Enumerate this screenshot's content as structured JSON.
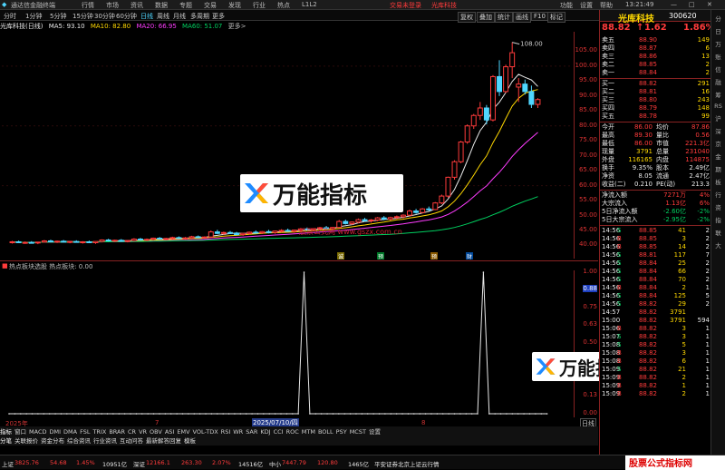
{
  "menu": {
    "app_title": "通达信金融终端",
    "items": [
      "行情",
      "市场",
      "资讯",
      "数据",
      "专题",
      "交易",
      "发现",
      "行业",
      "热点",
      "L1L2"
    ],
    "trade_login": "交易未登录",
    "stock_name": "光库科技",
    "right": [
      "功能",
      "设置",
      "帮助"
    ],
    "clock": "13:21:49"
  },
  "toolbar": {
    "periods": [
      "分时",
      "1分钟",
      "5分钟",
      "15分钟",
      "30分钟",
      "60分钟",
      "日线",
      "周线",
      "月线",
      "多周期",
      "更多"
    ],
    "active": "日线",
    "right": [
      "复权",
      "叠加",
      "统计",
      "画线",
      "F10",
      "标记"
    ]
  },
  "ma_bar": {
    "label": "光库科技(日线)",
    "ma5": "MA5: 93.10",
    "ma10": "MA10: 82.80",
    "ma20": "MA20: 66.95",
    "ma60": "MA60: 51.07"
  },
  "price_axis": {
    "labels": [
      "105.00",
      "100.00",
      "95.00",
      "90.00",
      "85.00",
      "80.00",
      "75.00",
      "70.00",
      "65.00",
      "60.00",
      "55.00",
      "50.00",
      "45.00",
      "40.00"
    ],
    "high_label": "108.00"
  },
  "indicator": {
    "title": "热点板块选股 热点板块: 0.00",
    "axis_labels": [
      "1.00",
      "0.88",
      "0.75",
      "0.63",
      "0.50",
      "0.38",
      "0.25",
      "0.13",
      "0.00"
    ],
    "highlight": "0.88"
  },
  "dates": {
    "left": "2025年",
    "mid": "2025/07/10/四",
    "m1": "7",
    "m2": "8"
  },
  "events": [
    "诚",
    "预",
    "预",
    "财"
  ],
  "watermark": {
    "text": "万能指标",
    "url": "股票公式网 www.gszx.com.cn"
  },
  "indicator_tabs": [
    "指标",
    "窗口",
    "MACD",
    "DMI",
    "DMA",
    "FSL",
    "TRIX",
    "BRAR",
    "CR",
    "VR",
    "OBV",
    "ASI",
    "EMV",
    "VOL-TDX",
    "RSI",
    "WR",
    "SAR",
    "KDJ",
    "CCI",
    "ROC",
    "MTM",
    "BOLL",
    "PSY",
    "MCST",
    "设置"
  ],
  "bottom_tabs": [
    "分笔",
    "关联报价",
    "资金分布",
    "综合资讯",
    "行业资讯",
    "互动问答",
    "最新解答回复",
    "模板"
  ],
  "quote": {
    "name": "光库科技",
    "code": "300620",
    "price": "88.82",
    "change": "1.62",
    "pct": "1.86%",
    "asks": [
      [
        "卖五",
        "88.90",
        "149"
      ],
      [
        "卖四",
        "88.87",
        "6"
      ],
      [
        "卖三",
        "88.86",
        "13"
      ],
      [
        "卖二",
        "88.85",
        "2"
      ],
      [
        "卖一",
        "88.84",
        "2"
      ]
    ],
    "bids": [
      [
        "买一",
        "88.82",
        "291"
      ],
      [
        "买二",
        "88.81",
        "16"
      ],
      [
        "买三",
        "88.80",
        "243"
      ],
      [
        "买四",
        "88.79",
        "148"
      ],
      [
        "买五",
        "88.78",
        "99"
      ]
    ],
    "stats": [
      [
        "今开",
        "86.00",
        "均价",
        "87.86"
      ],
      [
        "最高",
        "89.30",
        "量比",
        "0.56"
      ],
      [
        "最低",
        "86.00",
        "市值",
        "221.3亿"
      ],
      [
        "现量",
        "3791",
        "总量",
        "231040"
      ],
      [
        "外盘",
        "116165",
        "内盘",
        "114875"
      ],
      [
        "换手",
        "9.35%",
        "股本",
        "2.49亿"
      ],
      [
        "净资",
        "8.05",
        "流通",
        "2.47亿"
      ],
      [
        "收益(二)",
        "0.210",
        "PE(动)",
        "213.3"
      ]
    ],
    "flows": [
      [
        "净流入额",
        "7271万",
        "4%"
      ],
      [
        "大宗流入",
        "1.13亿",
        "6%"
      ],
      [
        "5日净流入额",
        "-2.60亿",
        "-2%"
      ],
      [
        "5日大宗流入",
        "-2.95亿",
        "-2%"
      ]
    ],
    "ticks": [
      [
        "14:56",
        "88.85",
        "41",
        "S",
        "2"
      ],
      [
        "14:56",
        "88.85",
        "3",
        "B",
        "2"
      ],
      [
        "14:56",
        "88.85",
        "14",
        "B",
        "2"
      ],
      [
        "14:56",
        "88.81",
        "117",
        "S",
        "7"
      ],
      [
        "14:56",
        "88.84",
        "25",
        "S",
        "2"
      ],
      [
        "14:56",
        "88.84",
        "66",
        "S",
        "2"
      ],
      [
        "14:56",
        "88.84",
        "70",
        "S",
        "2"
      ],
      [
        "14:56",
        "88.84",
        "2",
        "B",
        "1"
      ],
      [
        "14:56",
        "88.84",
        "125",
        "S",
        "5"
      ],
      [
        "14:56",
        "88.82",
        "29",
        "S",
        "2"
      ],
      [
        "14:57",
        "88.82",
        "3791",
        "",
        ""
      ],
      [
        "15:00",
        "88.82",
        "3791",
        "",
        "594"
      ],
      [
        "15:06",
        "88.82",
        "3",
        "B",
        "1"
      ],
      [
        "15:07",
        "88.82",
        "3",
        "S",
        "1"
      ],
      [
        "15:08",
        "88.82",
        "5",
        "S",
        "1"
      ],
      [
        "15:08",
        "88.82",
        "3",
        "B",
        "1"
      ],
      [
        "15:08",
        "88.82",
        "6",
        "B",
        "1"
      ],
      [
        "15:09",
        "88.82",
        "21",
        "S",
        "1"
      ],
      [
        "15:09",
        "88.82",
        "2",
        "B",
        "1"
      ],
      [
        "15:09",
        "88.82",
        "1",
        "B",
        "1"
      ],
      [
        "15:09",
        "88.82",
        "2",
        "B",
        "1"
      ]
    ]
  },
  "side_items": [
    "分",
    "日",
    "万",
    "账",
    "信",
    "融",
    "筹",
    "RS",
    "沪",
    "深",
    "京",
    "金",
    "期",
    "板",
    "行",
    "资",
    "指",
    "联",
    "大"
  ],
  "status": [
    {
      "t": "上证",
      "c": "wht"
    },
    {
      "t": "3825.76",
      "c": "red"
    },
    {
      "t": "54.68",
      "c": "red"
    },
    {
      "t": "1.45%",
      "c": "red"
    },
    {
      "t": "10951亿",
      "c": "wht"
    },
    {
      "t": "深证",
      "c": "wht"
    },
    {
      "t": "12166.1",
      "c": "red"
    },
    {
      "t": "263.30",
      "c": "red"
    },
    {
      "t": "2.07%",
      "c": "red"
    },
    {
      "t": "14516亿",
      "c": "wht"
    },
    {
      "t": "中小",
      "c": "wht"
    },
    {
      "t": "7447.79",
      "c": "red"
    },
    {
      "t": "120.80",
      "c": "red"
    },
    {
      "t": "1465亿",
      "c": "wht"
    },
    {
      "t": "平安证券北京上证云行情",
      "c": "wht"
    }
  ],
  "brand": "股票公式指标网",
  "brand_url": "www.gszx.com.cn",
  "chart_data": {
    "type": "candlestick",
    "ylim": [
      38,
      110
    ],
    "candles": [
      [
        41,
        41.5,
        40.6,
        41.2
      ],
      [
        41.2,
        41.6,
        40.8,
        40.9
      ],
      [
        40.9,
        41.3,
        40.5,
        41.0
      ],
      [
        41.0,
        41.4,
        40.7,
        40.8
      ],
      [
        40.8,
        41.2,
        40.4,
        41.1
      ],
      [
        41.1,
        41.8,
        40.9,
        41.5
      ],
      [
        41.5,
        41.9,
        41.0,
        41.2
      ],
      [
        41.2,
        41.6,
        40.8,
        41.4
      ],
      [
        41.4,
        41.8,
        41.0,
        41.1
      ],
      [
        41.1,
        41.5,
        40.7,
        41.3
      ],
      [
        41.3,
        41.7,
        40.9,
        41.0
      ],
      [
        41.0,
        41.4,
        40.6,
        41.2
      ],
      [
        41.2,
        41.6,
        40.8,
        40.9
      ],
      [
        40.9,
        41.3,
        40.5,
        41.3
      ],
      [
        41.3,
        42.0,
        41.0,
        41.8
      ],
      [
        41.8,
        42.2,
        41.3,
        41.5
      ],
      [
        41.5,
        41.9,
        41.1,
        41.7
      ],
      [
        41.7,
        42.1,
        41.2,
        41.4
      ],
      [
        41.4,
        41.8,
        41.0,
        41.6
      ],
      [
        41.6,
        42.4,
        41.3,
        42.1
      ],
      [
        42.1,
        42.5,
        41.6,
        41.8
      ],
      [
        41.8,
        42.3,
        41.4,
        42.0
      ],
      [
        42.0,
        42.6,
        41.6,
        42.4
      ],
      [
        42.4,
        42.8,
        41.9,
        42.1
      ],
      [
        42.1,
        42.5,
        41.7,
        42.3
      ],
      [
        42.3,
        42.9,
        41.9,
        42.6
      ],
      [
        42.6,
        43.0,
        42.1,
        42.3
      ],
      [
        42.3,
        42.8,
        41.9,
        42.5
      ],
      [
        42.5,
        43.2,
        42.1,
        42.9
      ],
      [
        42.9,
        43.3,
        42.4,
        42.6
      ],
      [
        42.6,
        43.0,
        42.2,
        42.8
      ],
      [
        42.8,
        45.0,
        42.5,
        44.5
      ],
      [
        44.5,
        45.2,
        43.8,
        44.0
      ],
      [
        44.0,
        44.6,
        43.5,
        44.3
      ],
      [
        44.3,
        44.8,
        43.8,
        44.1
      ],
      [
        44.1,
        44.5,
        43.4,
        43.6
      ],
      [
        43.6,
        44.2,
        43.2,
        44.0
      ],
      [
        44.0,
        44.6,
        43.6,
        44.4
      ],
      [
        44.4,
        45.0,
        43.9,
        44.2
      ],
      [
        44.2,
        44.8,
        43.8,
        44.6
      ],
      [
        44.6,
        45.2,
        44.0,
        44.3
      ],
      [
        44.3,
        45.0,
        43.9,
        44.8
      ],
      [
        44.8,
        45.4,
        44.3,
        45.0
      ],
      [
        45.0,
        45.6,
        44.5,
        44.7
      ],
      [
        44.7,
        45.2,
        44.2,
        45.1
      ],
      [
        45.1,
        45.8,
        44.7,
        45.5
      ],
      [
        45.5,
        46.0,
        45.0,
        45.2
      ],
      [
        45.2,
        45.7,
        44.8,
        45.6
      ],
      [
        45.6,
        46.2,
        45.1,
        45.9
      ],
      [
        45.9,
        46.5,
        45.4,
        45.6
      ],
      [
        45.6,
        46.1,
        45.2,
        46.0
      ],
      [
        46.0,
        48.5,
        45.8,
        48.0
      ],
      [
        48.0,
        48.6,
        47.0,
        47.3
      ],
      [
        47.3,
        48.0,
        46.8,
        47.8
      ],
      [
        47.8,
        49.0,
        47.4,
        48.6
      ],
      [
        48.6,
        49.2,
        47.9,
        48.2
      ],
      [
        48.2,
        48.8,
        47.6,
        48.5
      ],
      [
        48.5,
        49.5,
        48.1,
        49.2
      ],
      [
        49.2,
        49.8,
        48.4,
        48.8
      ],
      [
        48.8,
        49.6,
        48.3,
        49.3
      ],
      [
        49.3,
        50.0,
        48.8,
        49.6
      ],
      [
        49.6,
        50.4,
        49.0,
        50.1
      ],
      [
        50.1,
        52.0,
        49.8,
        51.5
      ],
      [
        51.5,
        52.2,
        50.6,
        51.0
      ],
      [
        51.0,
        52.5,
        50.7,
        52.2
      ],
      [
        52.2,
        53.0,
        51.5,
        52.0
      ],
      [
        52.0,
        54.5,
        51.8,
        54.2
      ],
      [
        54.2,
        57.0,
        53.8,
        56.5
      ],
      [
        56.5,
        63.0,
        56.0,
        62.8
      ],
      [
        62.8,
        68.5,
        62.0,
        68.0
      ],
      [
        68.0,
        75.0,
        67.5,
        74.6
      ],
      [
        74.6,
        80.5,
        74.0,
        80.0
      ],
      [
        80.0,
        84.0,
        79.0,
        83.5
      ],
      [
        83.5,
        88.0,
        82.0,
        86.0
      ],
      [
        86.0,
        87.0,
        80.5,
        82.0
      ],
      [
        82.0,
        97.0,
        81.5,
        96.5
      ],
      [
        96.5,
        102.0,
        90.0,
        91.5
      ],
      [
        91.5,
        100.5,
        91.0,
        99.8
      ],
      [
        99.8,
        108.0,
        96.0,
        104.5
      ],
      [
        93.0,
        96.0,
        88.0,
        94.0
      ],
      [
        94.0,
        95.5,
        90.5,
        91.5
      ],
      [
        91.5,
        93.5,
        86.0,
        87.2
      ],
      [
        87.2,
        89.3,
        86.0,
        88.82
      ]
    ],
    "indicator_series": [
      0,
      0,
      0,
      0,
      0,
      0,
      0,
      0,
      0,
      0,
      0,
      0,
      0,
      0,
      0,
      0,
      0,
      0,
      0,
      0,
      0,
      0,
      0,
      0,
      0,
      0,
      0,
      0,
      0,
      0,
      0,
      0,
      0,
      0,
      0,
      0,
      0,
      0,
      0,
      0,
      0,
      0,
      0,
      0,
      0,
      0,
      0,
      0,
      0,
      0,
      0,
      1,
      0,
      0,
      0,
      0,
      0,
      0,
      0,
      0,
      0,
      0,
      0,
      0,
      0,
      0,
      0,
      0,
      0,
      0,
      0,
      0,
      0,
      0,
      0,
      0,
      0,
      0,
      0,
      0,
      0,
      0,
      1,
      0,
      0,
      0,
      0,
      0,
      0,
      0,
      0,
      0,
      0,
      0
    ]
  }
}
